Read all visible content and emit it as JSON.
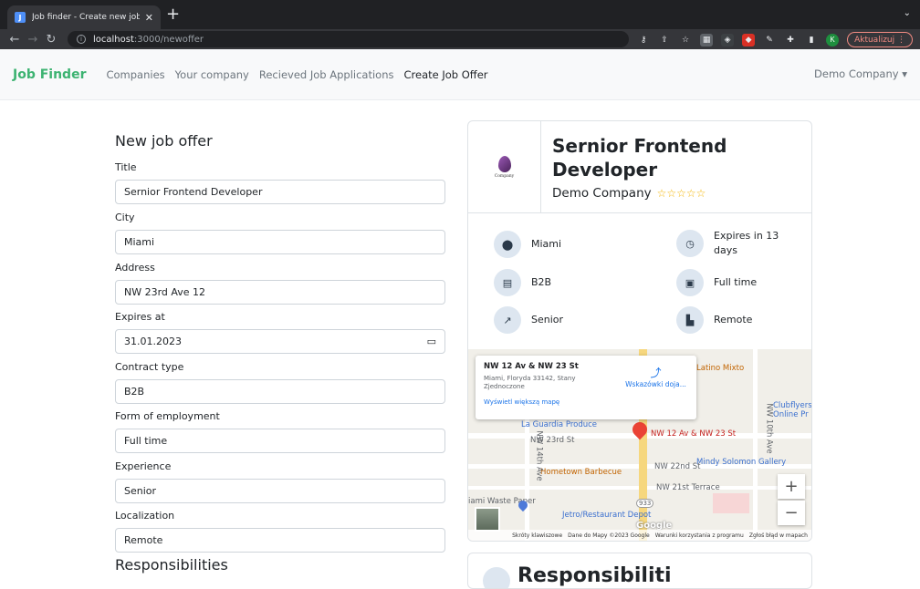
{
  "browser": {
    "tab_title": "Job finder - Create new job offer",
    "url_host": "localhost",
    "url_rest": ":3000/newoffer",
    "update_label": "Aktualizuj",
    "profile_initial": "K"
  },
  "nav": {
    "brand": "Job Finder",
    "links": [
      "Companies",
      "Your company",
      "Recieved Job Applications",
      "Create Job Offer"
    ],
    "active_link": "Create Job Offer",
    "account": "Demo Company"
  },
  "form": {
    "title": "New job offer",
    "fields": [
      {
        "label": "Title",
        "value": "Sernior Frontend Developer"
      },
      {
        "label": "City",
        "value": "Miami"
      },
      {
        "label": "Address",
        "value": "NW 23rd Ave 12"
      },
      {
        "label": "Expires at",
        "value": "31.01.2023"
      },
      {
        "label": "Contract type",
        "value": "B2B"
      },
      {
        "label": "Form of employment",
        "value": "Full time"
      },
      {
        "label": "Experience",
        "value": "Senior"
      },
      {
        "label": "Localization",
        "value": "Remote"
      }
    ],
    "next_section": "Responsibilities"
  },
  "preview": {
    "logo_text": "Company",
    "job_title": "Sernior Frontend Developer",
    "company": "Demo Company",
    "stars": "☆☆☆☆☆",
    "rating": 0,
    "info": [
      {
        "icon": "location-pin-icon",
        "text": "Miami"
      },
      {
        "icon": "clock-icon",
        "text": "Expires in 13 days"
      },
      {
        "icon": "document-icon",
        "text": "B2B"
      },
      {
        "icon": "briefcase-clock-icon",
        "text": "Full time"
      },
      {
        "icon": "chart-line-icon",
        "text": "Senior"
      },
      {
        "icon": "home-office-icon",
        "text": "Remote"
      }
    ],
    "next_card_title": "Responsibiliti"
  },
  "map": {
    "popup_title": "NW 12 Av & NW 23 St",
    "popup_address": "Miami, Floryda 33142, Stany Zjednoczone",
    "popup_link": "Wyświetl większą mapę",
    "directions": "Wskazówki doja...",
    "places": [
      "Latino Mixto",
      "Clubflyers Online Pr",
      "La Guardia Produce",
      "NW 12 Av & NW 23 St",
      "Hometown Barbecue",
      "Mindy Solomon Gallery",
      "iami Waste Paper",
      "Jetro/Restaurant Depot"
    ],
    "streets": [
      "NW 23rd St",
      "NW 22nd St",
      "NW 21st Terrace",
      "NW 14th Ave",
      "NW 10th Ave"
    ],
    "route": "933",
    "google": "Google",
    "attribution": [
      "Skróty klawiszowe",
      "Dane do Mapy ©2023 Google",
      "Warunki korzystania z programu",
      "Zgłoś błąd w mapach"
    ]
  }
}
